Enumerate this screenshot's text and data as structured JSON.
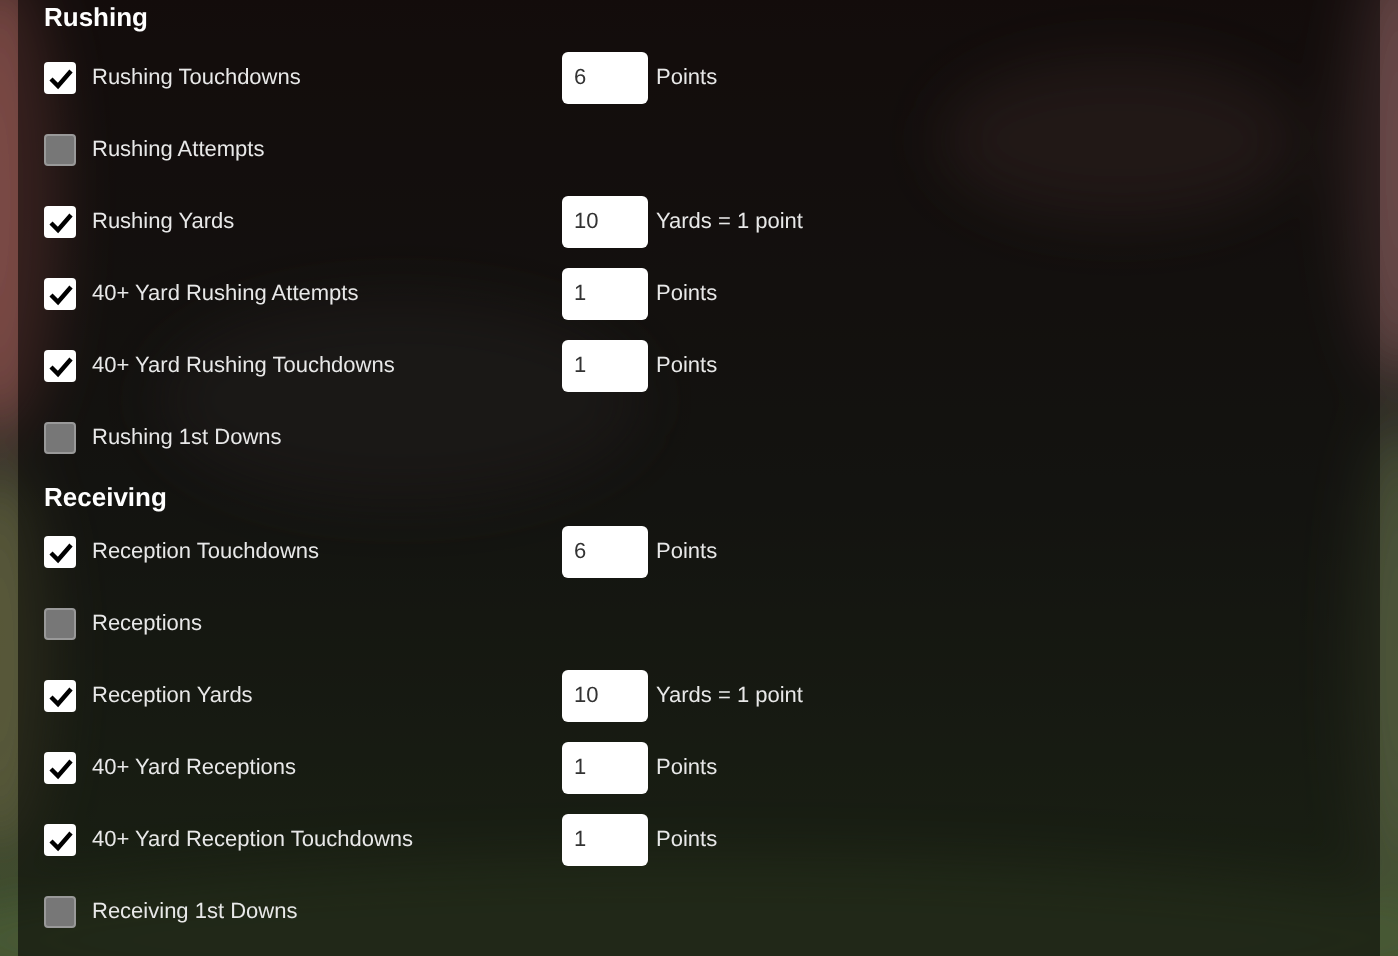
{
  "sections": [
    {
      "title": "Rushing",
      "items": [
        {
          "label": "Rushing Touchdowns",
          "checked": true,
          "value": "6",
          "unit": "Points"
        },
        {
          "label": "Rushing Attempts",
          "checked": false
        },
        {
          "label": "Rushing Yards",
          "checked": true,
          "value": "10",
          "unit": "Yards = 1 point"
        },
        {
          "label": "40+ Yard Rushing Attempts",
          "checked": true,
          "value": "1",
          "unit": "Points"
        },
        {
          "label": "40+ Yard Rushing Touchdowns",
          "checked": true,
          "value": "1",
          "unit": "Points"
        },
        {
          "label": "Rushing 1st Downs",
          "checked": false
        }
      ]
    },
    {
      "title": "Receiving",
      "items": [
        {
          "label": "Reception Touchdowns",
          "checked": true,
          "value": "6",
          "unit": "Points"
        },
        {
          "label": "Receptions",
          "checked": false
        },
        {
          "label": "Reception Yards",
          "checked": true,
          "value": "10",
          "unit": "Yards = 1 point"
        },
        {
          "label": "40+ Yard Receptions",
          "checked": true,
          "value": "1",
          "unit": "Points"
        },
        {
          "label": "40+ Yard Reception Touchdowns",
          "checked": true,
          "value": "1",
          "unit": "Points"
        },
        {
          "label": "Receiving 1st Downs",
          "checked": false
        }
      ]
    }
  ]
}
